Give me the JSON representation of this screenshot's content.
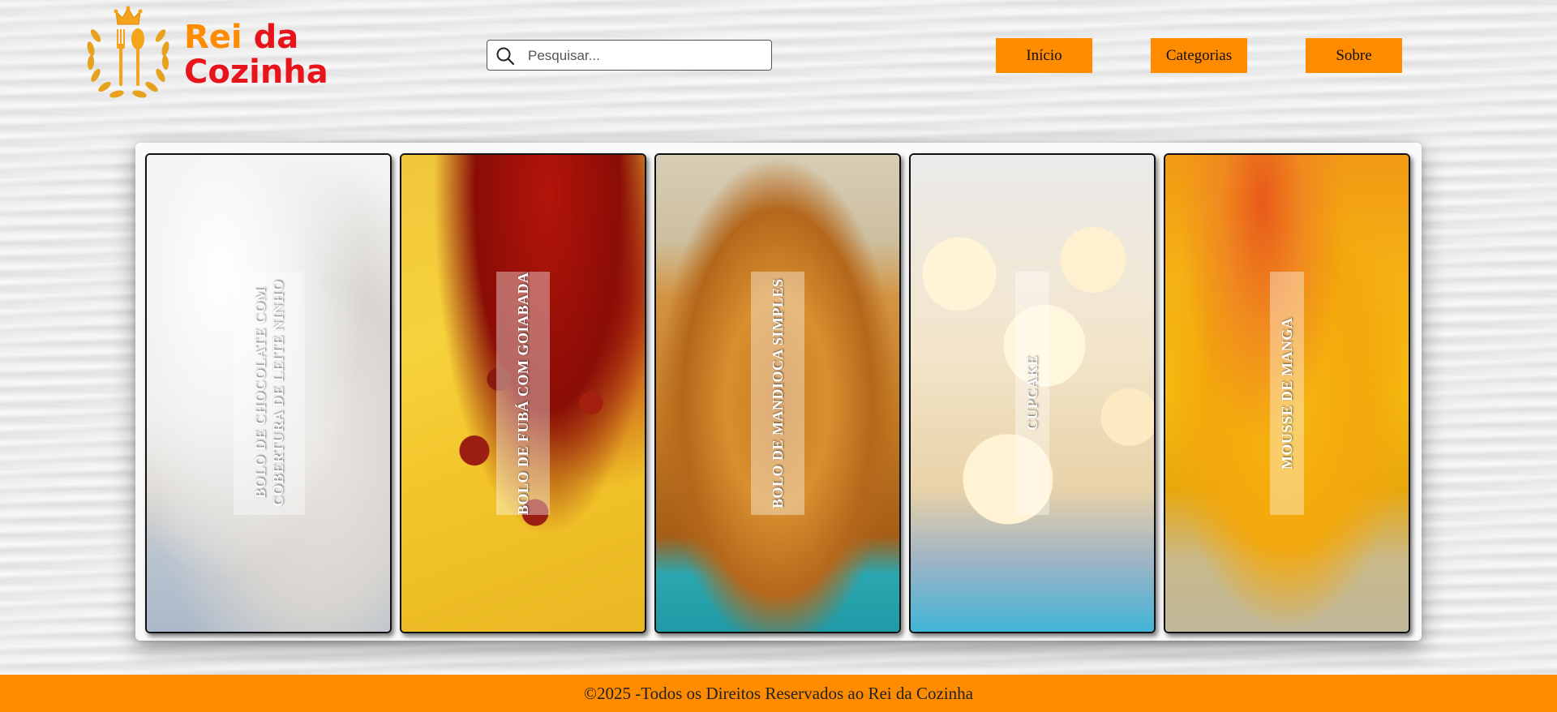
{
  "brand": {
    "name_part1": "Rei",
    "name_part2": "da",
    "name_line2": "Cozinha",
    "logo_icon": "crown-fork-spoon-laurel-icon",
    "primary_color": "#ff8c00",
    "secondary_color": "#e8141c"
  },
  "search": {
    "placeholder": "Pesquisar...",
    "value": "",
    "icon": "search-icon"
  },
  "nav": {
    "inicio": "Início",
    "categorias": "Categorias",
    "sobre": "Sobre"
  },
  "recipes": [
    {
      "title": "BOLO DE CHOCOLATE COM COBERTURA DE LEITE NINHO"
    },
    {
      "title": "BOLO DE FUBÁ COM GOIABADA"
    },
    {
      "title": "BOLO DE MANDIOCA SIMPLES"
    },
    {
      "title": "CUPCAKE"
    },
    {
      "title": "MOUSSE DE MANGA"
    }
  ],
  "footer": {
    "text": "©2025 -Todos os Direitos Reservados ao Rei da Cozinha"
  }
}
